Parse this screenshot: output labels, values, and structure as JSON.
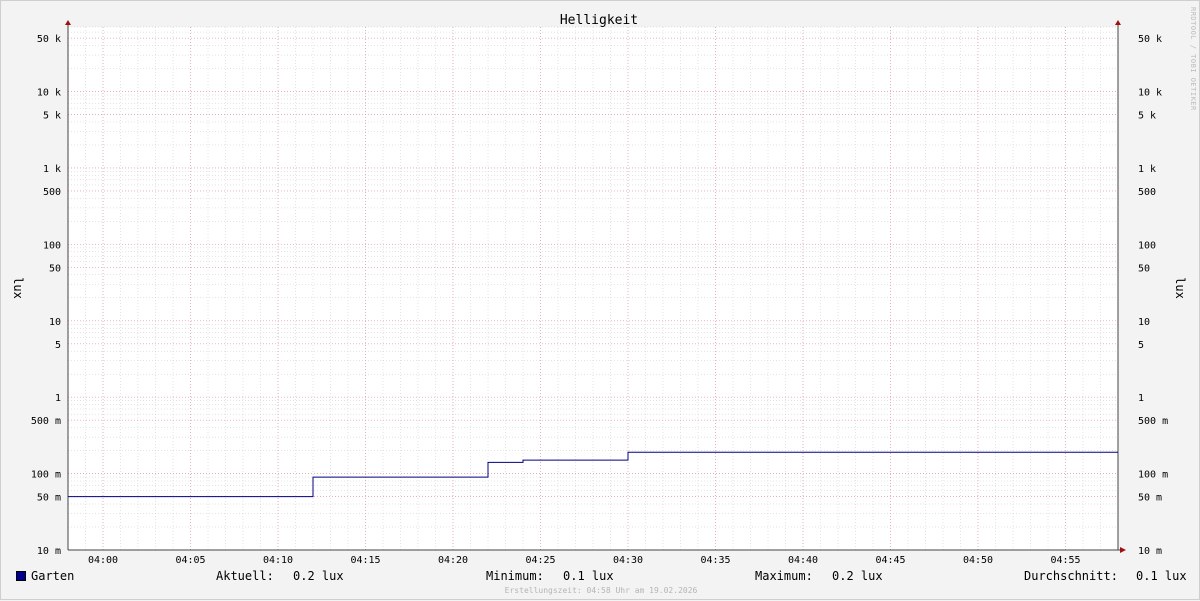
{
  "chart_data": {
    "type": "line",
    "title": "Helligkeit",
    "ylabel": "lux",
    "yscale": "log",
    "ylim": [
      0.01,
      70000
    ],
    "xlim": [
      "03:58",
      "04:58"
    ],
    "x_ticks": [
      "04:00",
      "04:05",
      "04:10",
      "04:15",
      "04:20",
      "04:25",
      "04:30",
      "04:35",
      "04:40",
      "04:45",
      "04:50",
      "04:55"
    ],
    "y_ticks": [
      {
        "value": 50000,
        "label": "50 k"
      },
      {
        "value": 10000,
        "label": "10 k"
      },
      {
        "value": 5000,
        "label": "5 k"
      },
      {
        "value": 1000,
        "label": "1 k"
      },
      {
        "value": 500,
        "label": "500"
      },
      {
        "value": 100,
        "label": "100"
      },
      {
        "value": 50,
        "label": "50"
      },
      {
        "value": 10,
        "label": "10"
      },
      {
        "value": 5,
        "label": "5"
      },
      {
        "value": 1,
        "label": "1"
      },
      {
        "value": 0.5,
        "label": "500 m"
      },
      {
        "value": 0.1,
        "label": "100 m"
      },
      {
        "value": 0.05,
        "label": "50 m"
      },
      {
        "value": 0.01,
        "label": "10 m"
      }
    ],
    "grid": true,
    "series": [
      {
        "name": "Garten",
        "color": "#000080",
        "step": true,
        "x": [
          "03:58",
          "04:12",
          "04:22",
          "04:24",
          "04:30",
          "04:58"
        ],
        "y": [
          0.05,
          0.09,
          0.14,
          0.15,
          0.19,
          0.19
        ]
      }
    ]
  },
  "legend": {
    "series_name": "Garten",
    "swatch_color": "#00008f",
    "current_label": "Aktuell:",
    "current_value": "0.2 lux",
    "min_label": "Minimum:",
    "min_value": "0.1 lux",
    "max_label": "Maximum:",
    "max_value": "0.2 lux",
    "avg_label": "Durchschnitt:",
    "avg_value": "0.1 lux"
  },
  "footer_text": "Erstellungszeit: 04:58 Uhr am 19.02.2026",
  "watermark_text": "RRDTOOL / TOBI OETIKER",
  "colors": {
    "major_grid": "#e89090",
    "minor_grid": "#c8c8c8",
    "axis": "#444444",
    "arrow": "#a01010",
    "plot_bg": "#ffffff"
  }
}
